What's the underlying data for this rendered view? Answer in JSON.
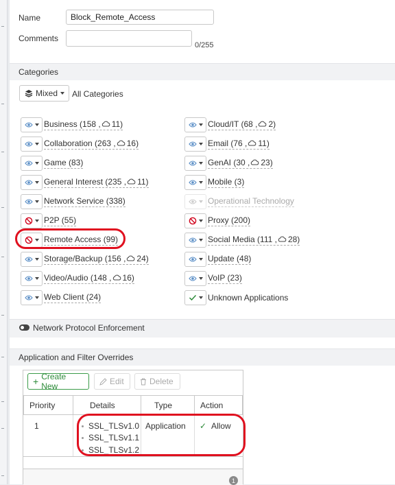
{
  "form": {
    "name_label": "Name",
    "name_value": "Block_Remote_Access",
    "comments_label": "Comments",
    "comments_value": "",
    "comments_counter": "0/255"
  },
  "categories": {
    "section_title": "Categories",
    "mixed_label": "Mixed",
    "all_label": "All Categories",
    "left": [
      {
        "label": "Business (158 ,",
        "cloud": "11)",
        "action": "monitor"
      },
      {
        "label": "Collaboration (263 ,",
        "cloud": "16)",
        "action": "monitor"
      },
      {
        "label": "Game (83)",
        "cloud": "",
        "action": "monitor"
      },
      {
        "label": "General Interest (235 ,",
        "cloud": "11)",
        "action": "monitor"
      },
      {
        "label": "Network Service (338)",
        "cloud": "",
        "action": "monitor"
      },
      {
        "label": "P2P (55)",
        "cloud": "",
        "action": "block"
      },
      {
        "label": "Remote Access (99)",
        "cloud": "",
        "action": "block"
      },
      {
        "label": "Storage/Backup (156 ,",
        "cloud": "24)",
        "action": "monitor"
      },
      {
        "label": "Video/Audio (148 ,",
        "cloud": "16)",
        "action": "monitor"
      },
      {
        "label": "Web Client (24)",
        "cloud": "",
        "action": "monitor"
      }
    ],
    "right": [
      {
        "label": "Cloud/IT (68 ,",
        "cloud": "2)",
        "action": "monitor"
      },
      {
        "label": "Email (76 ,",
        "cloud": "11)",
        "action": "monitor"
      },
      {
        "label": "GenAI (30 ,",
        "cloud": "23)",
        "action": "monitor"
      },
      {
        "label": "Mobile (3)",
        "cloud": "",
        "action": "monitor"
      },
      {
        "label": "Operational Technology",
        "cloud": "",
        "action": "disabled"
      },
      {
        "label": "Proxy (200)",
        "cloud": "",
        "action": "block"
      },
      {
        "label": "Social Media (111 ,",
        "cloud": "28)",
        "action": "monitor"
      },
      {
        "label": "Update (48)",
        "cloud": "",
        "action": "monitor"
      },
      {
        "label": "VoIP (23)",
        "cloud": "",
        "action": "monitor"
      },
      {
        "label": "Unknown Applications",
        "cloud": "",
        "action": "allow"
      }
    ]
  },
  "protocol": {
    "label": "Network Protocol Enforcement",
    "enabled": false
  },
  "overrides": {
    "section_title": "Application and Filter Overrides",
    "create_label": "Create New",
    "edit_label": "Edit",
    "delete_label": "Delete",
    "columns": [
      "Priority",
      "Details",
      "Type",
      "Action"
    ],
    "rows": [
      {
        "priority": "1",
        "details": [
          "SSL_TLSv1.0",
          "SSL_TLSv1.1",
          "SSL_TLSv1.2"
        ],
        "type": "Application",
        "action": "Allow"
      }
    ],
    "page_count": "1"
  },
  "colors": {
    "highlight": "#e0101f",
    "allow": "#2e8b3a",
    "block": "#d0021b",
    "monitor": "#5b8fc7"
  }
}
